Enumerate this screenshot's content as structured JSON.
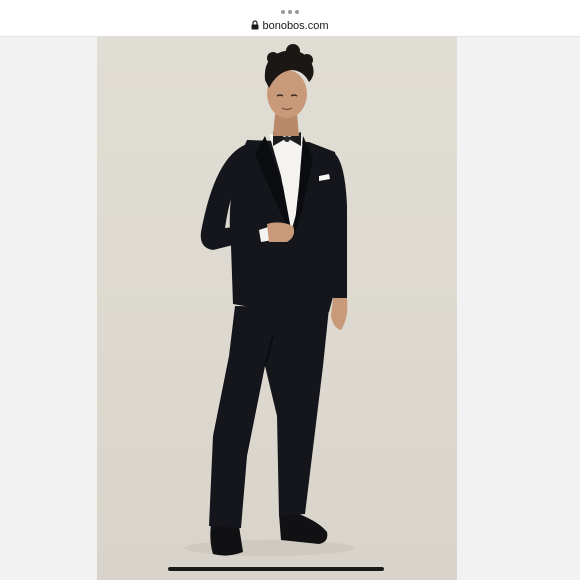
{
  "browser": {
    "domain": "bonobos.com",
    "lock_icon": "lock-icon",
    "menu_icon": "more-dots-icon"
  },
  "product_photo": {
    "subject": "model-in-black-tuxedo",
    "colors": {
      "background": "#dedad1",
      "suit": "#15161c",
      "shirt": "#f4f3ef",
      "skin": "#c99a79",
      "hair": "#1a1714"
    }
  }
}
